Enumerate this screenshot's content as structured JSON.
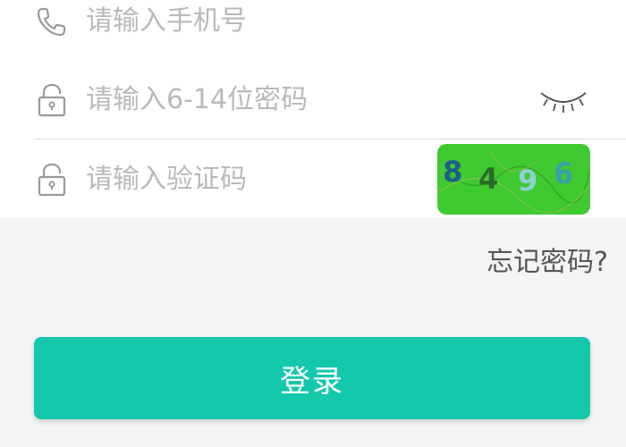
{
  "form": {
    "phone": {
      "placeholder": "请输入手机号",
      "value": "",
      "icon": "phone-icon"
    },
    "password": {
      "placeholder": "请输入6-14位密码",
      "value": "",
      "icon": "lock-icon",
      "toggle_icon": "eye-closed-icon"
    },
    "captcha": {
      "placeholder": "请输入验证码",
      "value": "",
      "icon": "lock-icon",
      "code": [
        "8",
        "4",
        "9",
        "6"
      ],
      "code_colors": [
        "#1d5c8a",
        "#2b6b2a",
        "#8fd0d8",
        "#3aa0a8"
      ],
      "background": "#3fcb2f"
    }
  },
  "forgot_password": "忘记密码?",
  "login_button": {
    "label": "登录",
    "color": "#14c8ab"
  },
  "colors": {
    "background": "#f4f4f4",
    "card": "#ffffff",
    "placeholder": "#b9b9b9",
    "icon": "#9a9a9a"
  }
}
